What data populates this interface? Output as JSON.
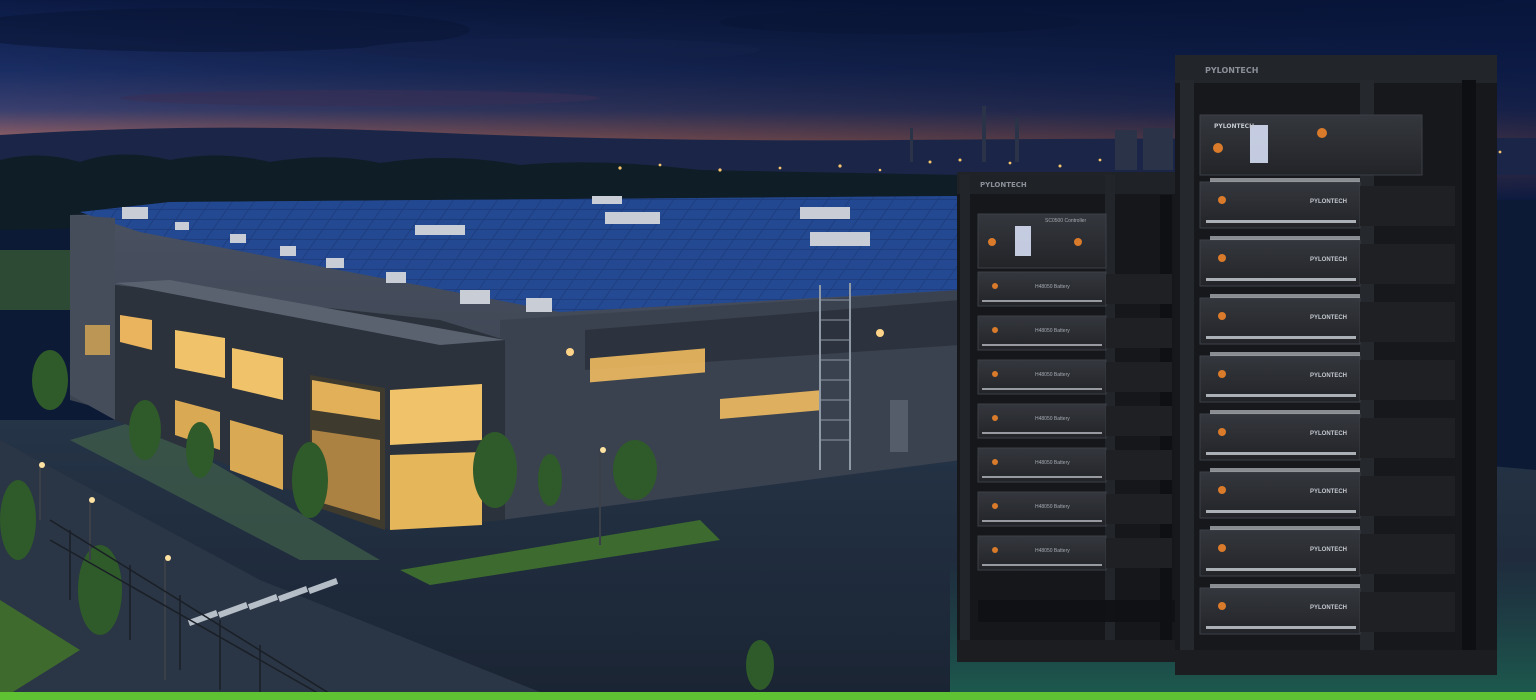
{
  "scene": {
    "description_colors": {
      "sky_top": "#0e1f4a",
      "sky_horizon": "#e58a5a",
      "building_wall": "#3c4350",
      "window_glow": "#f2c36a",
      "solar_panel": "#1c3c78",
      "rack_frame": "#1b1d21",
      "battery_module": "#2a2d33",
      "accent_green": "#5fc232"
    }
  },
  "racks": {
    "small": {
      "brand_label": "PYLONTECH",
      "controller_label": "SC0500 Controller",
      "module_label": "H48050 Battery",
      "module_count": 7
    },
    "large": {
      "brand_label": "PYLONTECH",
      "module_label": "PYLONTECH",
      "module_count": 8
    }
  },
  "footer_bar": {
    "color": "#5fc232"
  }
}
